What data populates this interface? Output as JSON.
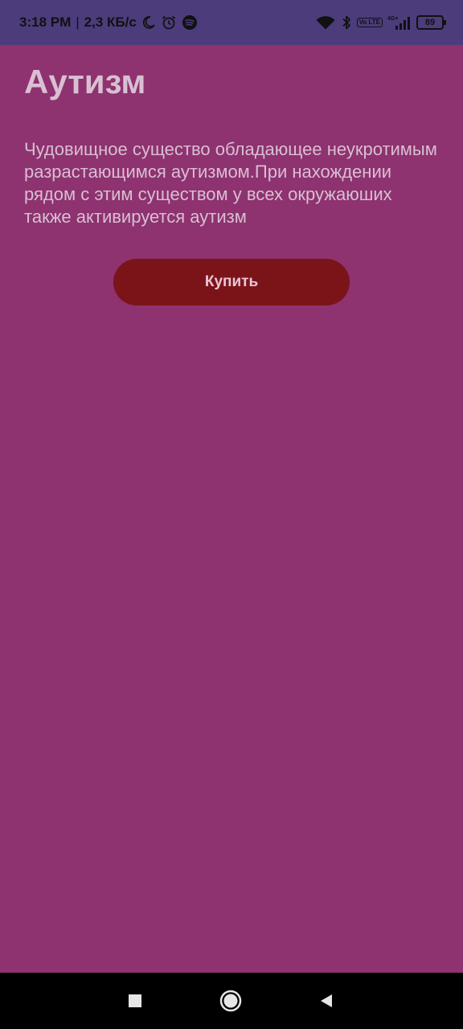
{
  "status_bar": {
    "time": "3:18 PM",
    "separator": "|",
    "speed": "2,3 КБ/с",
    "battery": "89",
    "network_label": "4G+",
    "volte_label": "Vo LTE",
    "icons": [
      "moon-icon",
      "alarm-icon",
      "spotify-icon",
      "wifi-icon",
      "bluetooth-icon",
      "signal-icon",
      "battery-icon"
    ]
  },
  "item": {
    "title": "Аутизм",
    "description": "Чудовищное существо обладающее неукротимым разрастающимся аутизмом.При нахождении рядом с этим существом у всех окружаюших также активируется аутизм",
    "buy_label": "Купить"
  },
  "colors": {
    "background": "#8e3270",
    "status_bar": "#4c3c7b",
    "button": "#7b1419",
    "text": "#d9bfd2"
  },
  "nav": {
    "icons": [
      "recents-square-icon",
      "home-circle-icon",
      "back-triangle-icon"
    ]
  }
}
